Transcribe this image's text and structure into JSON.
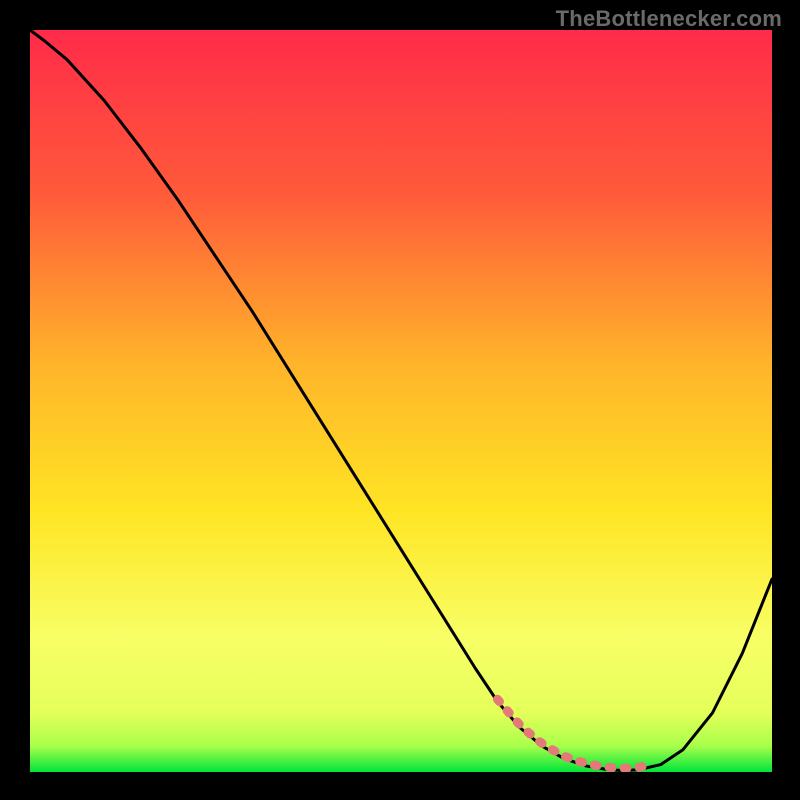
{
  "attribution": "TheBottlenecker.com",
  "colors": {
    "background": "#000000",
    "gradient_top": "#ff2b49",
    "gradient_upper_mid": "#ff8a2a",
    "gradient_mid": "#ffe524",
    "gradient_lower": "#f6ff7a",
    "gradient_bottom": "#00e53a",
    "curve": "#000000",
    "trough_marker": "#e47a77"
  },
  "chart_data": {
    "type": "line",
    "title": "",
    "xlabel": "",
    "ylabel": "",
    "x": [
      0,
      2,
      5,
      10,
      15,
      20,
      25,
      30,
      35,
      40,
      45,
      50,
      55,
      60,
      63,
      66,
      69,
      72,
      75,
      78,
      80,
      82,
      85,
      88,
      92,
      96,
      100
    ],
    "values": [
      100,
      98.5,
      96,
      90.5,
      84,
      77,
      69.5,
      62,
      54,
      46,
      38,
      30,
      22,
      14,
      9.5,
      6,
      3.5,
      1.8,
      0.8,
      0.3,
      0.2,
      0.3,
      1,
      3,
      8,
      16,
      26
    ],
    "xlim": [
      0,
      100
    ],
    "ylim": [
      0,
      100
    ],
    "trough_marker": {
      "x_range": [
        63,
        83
      ],
      "y_approx": 1.0
    },
    "notes": "Background is a vertical red→orange→yellow→green gradient. Curve descends from top-left, bottoms out near x≈78, then rises toward right edge. A coral-red dashed segment highlights the trough region."
  }
}
